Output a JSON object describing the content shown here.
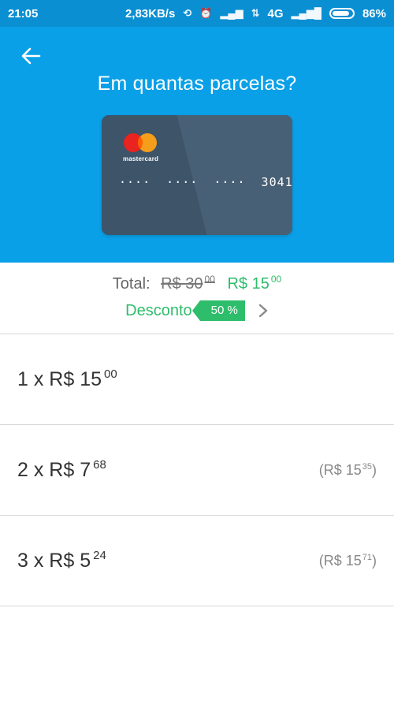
{
  "status_bar": {
    "time": "21:05",
    "speed": "2,83KB/s",
    "network": "4G",
    "battery": "86%"
  },
  "header": {
    "title": "Em quantas parcelas?",
    "back_icon": "arrow-left-icon"
  },
  "card": {
    "brand": "mastercard",
    "number": "····  ····  ····  3041"
  },
  "total": {
    "label": "Total:",
    "old_price": "R$ 30",
    "old_cents": "00",
    "new_price": "R$ 15",
    "new_cents": "00"
  },
  "discount": {
    "label": "Desconto",
    "badge": "50 %"
  },
  "options": [
    {
      "main": "1 x R$ 15",
      "main_cents": "00",
      "total": "",
      "total_cents": "",
      "total_close": ""
    },
    {
      "main": "2 x R$ 7",
      "main_cents": "68",
      "total": "(R$ 15",
      "total_cents": "35",
      "total_close": ")"
    },
    {
      "main": "3 x R$ 5",
      "main_cents": "24",
      "total": "(R$ 15",
      "total_cents": "71",
      "total_close": ")"
    }
  ],
  "colors": {
    "status_bar": "#0b8fd3",
    "header": "#0aa0e8",
    "accent_green": "#2ebd6b",
    "card": "#3d5469"
  }
}
